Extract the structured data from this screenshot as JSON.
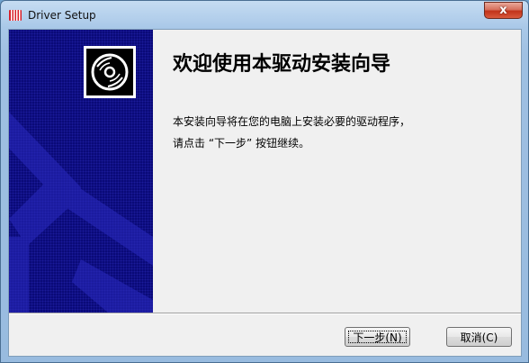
{
  "window": {
    "title": "Driver Setup",
    "close_label": "x"
  },
  "banner": {
    "logo_icon": "cd-disc-icon",
    "bg_color": "#0a0a78"
  },
  "content": {
    "heading": "欢迎使用本驱动安装向导",
    "description_lines": [
      "本安装向导将在您的电脑上安装必要的驱动程序，",
      "请点击 “下一步” 按钮继续。"
    ]
  },
  "buttons": {
    "next_label": "下一步(N)",
    "cancel_label": "取消(C)"
  }
}
